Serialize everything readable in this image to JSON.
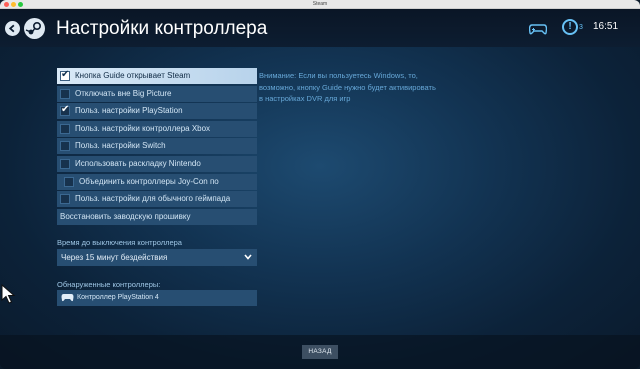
{
  "window": {
    "title": "Steam"
  },
  "header": {
    "title": "Настройки контроллера",
    "alert_count": "3",
    "clock": "16:51"
  },
  "options": [
    {
      "label": "Кнопка Guide открывает Steam",
      "checked": true,
      "highlight": true
    },
    {
      "label": "Отключать вне Big Picture",
      "checked": false
    },
    {
      "label": "Польз. настройки PlayStation",
      "checked": true
    },
    {
      "label": "Польз. настройки контроллера Xbox",
      "checked": false
    },
    {
      "label": "Польз. настройки Switch",
      "checked": false
    },
    {
      "label": "Использовать раскладку Nintendo",
      "checked": false
    },
    {
      "label": "Объединить контроллеры Joy-Con по",
      "checked": false
    },
    {
      "label": "Польз. настройки для обычного геймпада",
      "checked": false
    },
    {
      "label": "Восстановить заводскую прошивку",
      "button": true
    }
  ],
  "shutdown": {
    "label": "Время до выключения контроллера",
    "value": "Через 15 минут бездействия"
  },
  "detected": {
    "label": "Обнаруженные контроллеры:",
    "items": [
      "Контроллер PlayStation 4"
    ]
  },
  "info": "Внимание: Если вы пользуетесь Windows, то,\nвозможно, кнопку Guide нужно будет активировать\nв настройках DVR для игр",
  "footer": {
    "back_label": "НАЗАД"
  },
  "colors": {
    "accent": "#67c1f5",
    "row_bg": "#274e72",
    "highlight_bg": "#d9e9f7"
  }
}
